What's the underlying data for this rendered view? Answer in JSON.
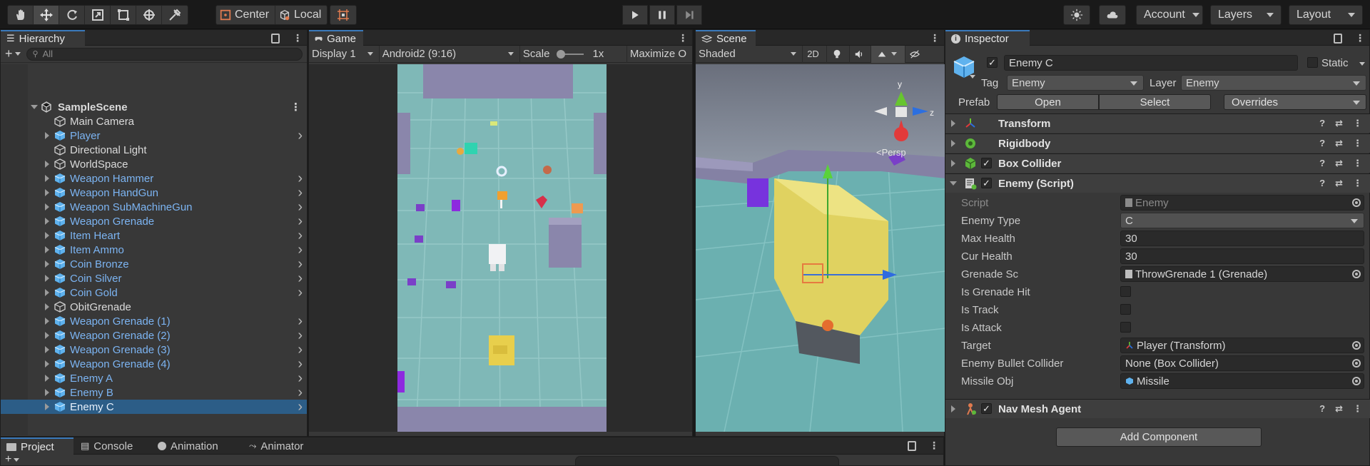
{
  "toolbar": {
    "center_label": "Center",
    "local_label": "Local",
    "account_label": "Account",
    "layers_label": "Layers",
    "layout_label": "Layout"
  },
  "hierarchy": {
    "tab_label": "Hierarchy",
    "search_placeholder": "All",
    "scene_name": "SampleScene",
    "items": [
      {
        "label": "Main Camera",
        "kind": "go",
        "fold": false,
        "chev": false
      },
      {
        "label": "Player",
        "kind": "prefab",
        "fold": true,
        "chev": true
      },
      {
        "label": "Directional Light",
        "kind": "go",
        "fold": false,
        "chev": false
      },
      {
        "label": "WorldSpace",
        "kind": "go",
        "fold": true,
        "chev": false
      },
      {
        "label": "Weapon Hammer",
        "kind": "prefab",
        "fold": true,
        "chev": true
      },
      {
        "label": "Weapon HandGun",
        "kind": "prefab",
        "fold": true,
        "chev": true
      },
      {
        "label": "Weapon SubMachineGun",
        "kind": "prefab",
        "fold": true,
        "chev": true
      },
      {
        "label": "Weapon Grenade",
        "kind": "prefab",
        "fold": true,
        "chev": true
      },
      {
        "label": "Item Heart",
        "kind": "prefab",
        "fold": true,
        "chev": true
      },
      {
        "label": "Item Ammo",
        "kind": "prefab",
        "fold": true,
        "chev": true
      },
      {
        "label": "Coin Bronze",
        "kind": "prefab",
        "fold": true,
        "chev": true
      },
      {
        "label": "Coin Silver",
        "kind": "prefab",
        "fold": true,
        "chev": true
      },
      {
        "label": "Coin Gold",
        "kind": "prefab",
        "fold": true,
        "chev": true
      },
      {
        "label": "ObitGrenade",
        "kind": "go",
        "fold": true,
        "chev": false
      },
      {
        "label": "Weapon Grenade (1)",
        "kind": "prefab",
        "fold": true,
        "chev": true
      },
      {
        "label": "Weapon Grenade (2)",
        "kind": "prefab",
        "fold": true,
        "chev": true
      },
      {
        "label": "Weapon Grenade (3)",
        "kind": "prefab",
        "fold": true,
        "chev": true
      },
      {
        "label": "Weapon Grenade (4)",
        "kind": "prefab",
        "fold": true,
        "chev": true
      },
      {
        "label": "Enemy A",
        "kind": "prefab",
        "fold": true,
        "chev": true
      },
      {
        "label": "Enemy B",
        "kind": "prefab",
        "fold": true,
        "chev": true
      },
      {
        "label": "Enemy C",
        "kind": "prefab",
        "fold": true,
        "chev": true,
        "selected": true
      }
    ]
  },
  "game": {
    "tab_label": "Game",
    "display": "Display 1",
    "resolution": "Android2 (9:16)",
    "scale_label": "Scale",
    "scale_value": "1x",
    "maximize_label": "Maximize O"
  },
  "scene": {
    "tab_label": "Scene",
    "shading": "Shaded",
    "mode_2d": "2D",
    "persp_label": "<Persp",
    "gizmo_y": "y",
    "gizmo_z": "z"
  },
  "inspector": {
    "tab_label": "Inspector",
    "object_name": "Enemy C",
    "static_label": "Static",
    "tag_label": "Tag",
    "tag_value": "Enemy",
    "layer_label": "Layer",
    "layer_value": "Enemy",
    "prefab_label": "Prefab",
    "open_label": "Open",
    "select_label": "Select",
    "overrides_label": "Overrides",
    "components": {
      "transform": "Transform",
      "rigidbody": "Rigidbody",
      "box_collider": "Box Collider",
      "enemy_script": "Enemy (Script)",
      "nav_mesh_agent": "Nav Mesh Agent"
    },
    "props": {
      "script_label": "Script",
      "script_value": "Enemy",
      "enemy_type_label": "Enemy Type",
      "enemy_type_value": "C",
      "max_health_label": "Max Health",
      "max_health_value": "30",
      "cur_health_label": "Cur Health",
      "cur_health_value": "30",
      "grenade_label": "Grenade Sc",
      "grenade_value": "ThrowGrenade 1 (Grenade)",
      "grenade_hit_label": "Is Grenade Hit",
      "is_track_label": "Is Track",
      "is_attack_label": "Is Attack",
      "target_label": "Target",
      "target_value": "Player (Transform)",
      "bullet_label": "Enemy Bullet Collider",
      "bullet_value": "None (Box Collider)",
      "missile_label": "Missile Obj",
      "missile_value": "Missile"
    },
    "add_component_label": "Add Component"
  },
  "bottom": {
    "tabs": [
      "Project",
      "Console",
      "Animation",
      "Animator"
    ]
  },
  "colors": {
    "accent": "#3a79bb",
    "selection": "#2c5d87",
    "prefab_blue": "#7cb4f2",
    "panel_bg": "#383838"
  }
}
